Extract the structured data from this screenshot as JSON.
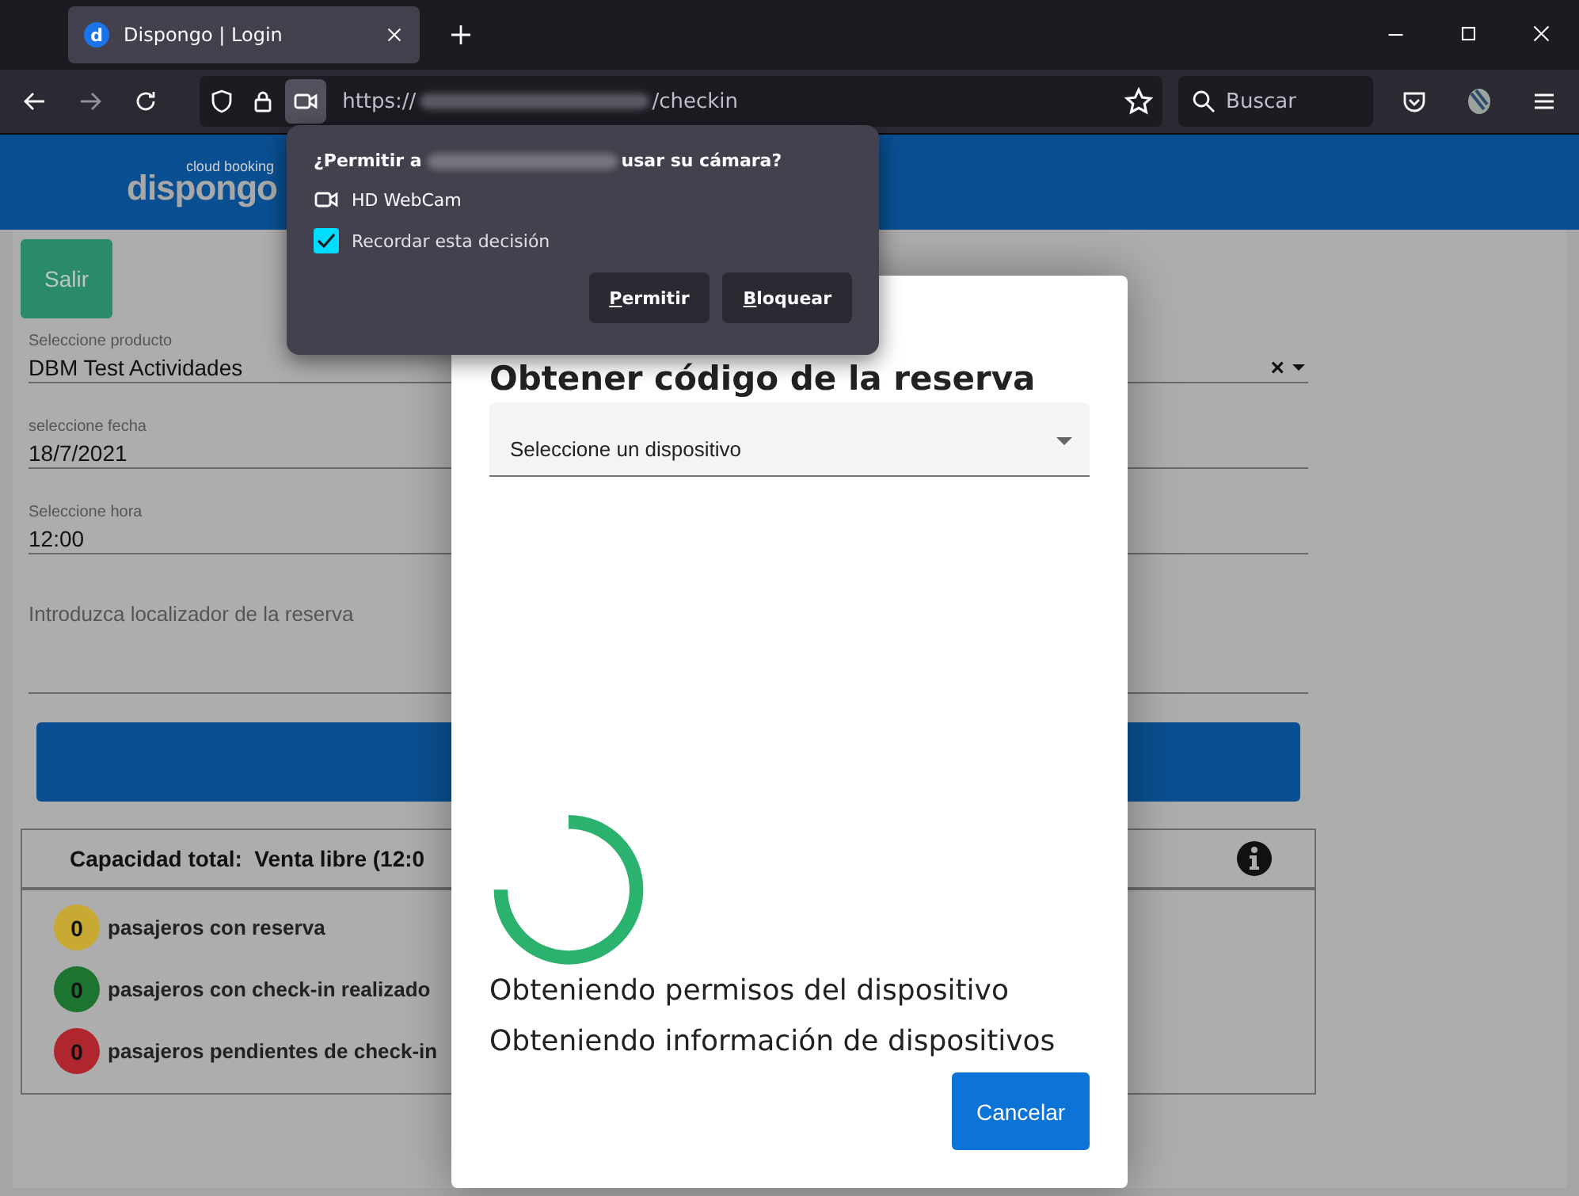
{
  "browser": {
    "tab": {
      "favicon": "d",
      "title": "Dispongo | Login"
    },
    "url": {
      "scheme": "https://",
      "path": "/checkin"
    },
    "search": {
      "placeholder": "Buscar"
    }
  },
  "permission_popup": {
    "prompt_start": "¿Permitir a",
    "prompt_end": "usar su cámara?",
    "device": "HD WebCam",
    "remember": {
      "label": "Recordar esta decisión",
      "checked": true
    },
    "buttons": [
      "Permitir",
      "Bloquear"
    ]
  },
  "header": {
    "logo_tagline": "cloud booking",
    "logo_name": "dispongo"
  },
  "page": {
    "exit_button": "Salir",
    "fields": [
      {
        "kind": "select",
        "label": "Seleccione producto",
        "value": "DBM Test Actividades",
        "clear": "×"
      },
      {
        "kind": "input",
        "label": "seleccione fecha",
        "value": "18/7/2021"
      },
      {
        "kind": "input",
        "label": "Seleccione hora",
        "value": "12:00"
      },
      {
        "kind": "textarea",
        "placeholder": "Introduzca localizador de la reserva"
      }
    ],
    "capacity": {
      "title": "Capacidad total:  Venta libre (12:0",
      "rows": [
        {
          "count": "0",
          "color": "#c8a934",
          "label": "pasajeros con reserva"
        },
        {
          "count": "0",
          "color": "#1c7430",
          "label": "pasajeros con check-in realizado"
        },
        {
          "count": "0",
          "color": "#b0262e",
          "label": "pasajeros pendientes de check-in"
        }
      ]
    }
  },
  "modal": {
    "title": "Obtener código de la reserva",
    "device_select": {
      "placeholder": "Seleccione un dispositivo"
    },
    "messages": [
      "Obteniendo permisos del dispositivo",
      "Obteniendo información de dispositivos"
    ],
    "cancel_button": "Cancelar"
  }
}
